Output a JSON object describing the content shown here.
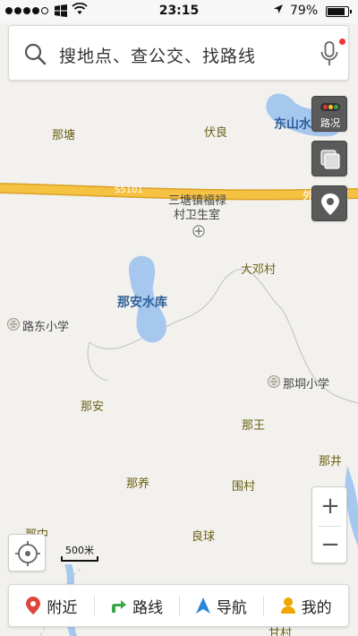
{
  "status_bar": {
    "carrier_icon": "windows-logo",
    "time": "23:15",
    "battery": "79%",
    "battery_level": 0.79,
    "signal_bars": 4
  },
  "search": {
    "placeholder": "搜地点、查公交、找路线"
  },
  "map": {
    "road_name": "S5101",
    "road_label_right": "外环高速",
    "places": {
      "natang": "那塘",
      "fuliang": "伏良",
      "dongshan_reservoir": "东山水库",
      "clinic_line1": "三塘镇福禄",
      "clinic_line2": "村卫生室",
      "dadeng": "大邓村",
      "naan_reservoir": "那安水库",
      "ludong_school": "路东小学",
      "natong_school": "那垌小学",
      "naan": "那安",
      "nawang": "那王",
      "najing": "那井",
      "nayang": "那养",
      "weicun": "围村",
      "liangqiu": "良球",
      "nazhong": "那中",
      "ganchun": "甘村"
    }
  },
  "controls": {
    "traffic_label": "路况",
    "zoom_in": "+",
    "zoom_out": "−",
    "scale_label": "500米"
  },
  "nav": {
    "nearby": "附近",
    "route": "路线",
    "navigation": "导航",
    "mine": "我的"
  },
  "colors": {
    "road": "#f5c242",
    "road_stroke": "#d9a126",
    "water": "#a6c8ef",
    "map_bg": "#f2f1ee",
    "nearby_icon": "#e0473c",
    "route_icon": "#3aa84b",
    "nav_icon": "#2c86d8",
    "mine_icon": "#f0a600"
  }
}
